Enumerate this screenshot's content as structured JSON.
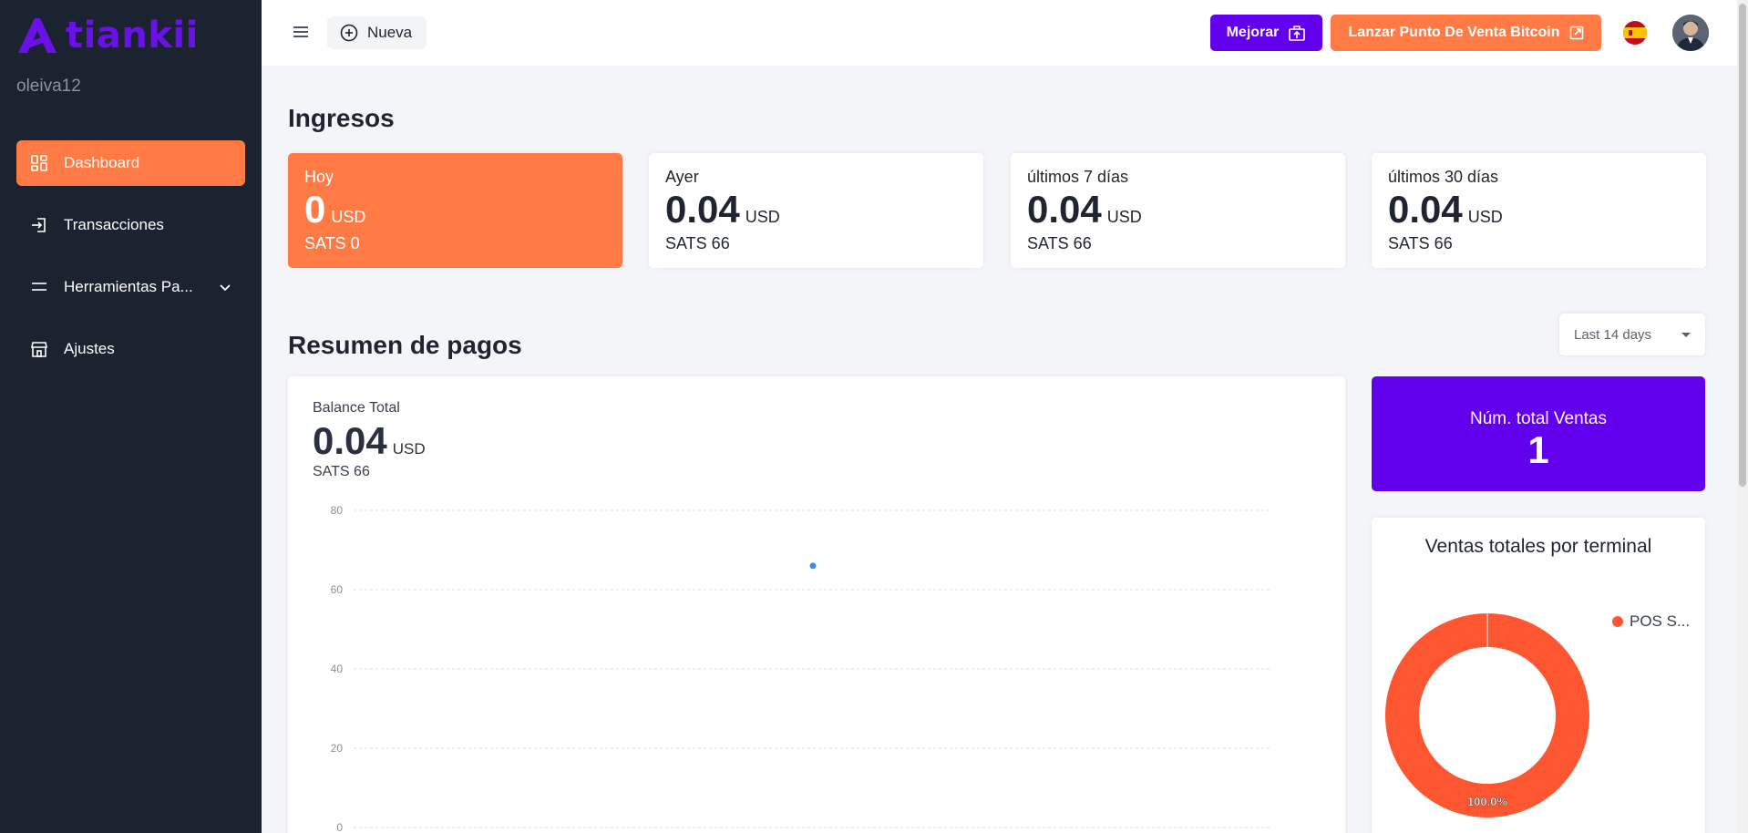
{
  "brand": {
    "name": "tiankii",
    "color": "#6a11e8"
  },
  "user": {
    "username": "oleiva12"
  },
  "sidebar": {
    "items": [
      {
        "label": "Dashboard",
        "icon": "dashboard-grid-icon",
        "active": true
      },
      {
        "label": "Transacciones",
        "icon": "transactions-icon"
      },
      {
        "label": "Herramientas Pa...",
        "icon": "tools-menu-icon",
        "expandable": true
      },
      {
        "label": "Ajustes",
        "icon": "store-icon"
      }
    ]
  },
  "header": {
    "nueva_label": "Nueva",
    "mejorar_label": "Mejorar",
    "lanzar_label": "Lanzar Punto De Venta Bitcoin",
    "language_flag": "spain-flag-icon"
  },
  "ingresos": {
    "title": "Ingresos",
    "cards": [
      {
        "label": "Hoy",
        "value": "0",
        "unit": "USD",
        "sats": "SATS 0"
      },
      {
        "label": "Ayer",
        "value": "0.04",
        "unit": "USD",
        "sats": "SATS 66"
      },
      {
        "label": "últimos 7 días",
        "value": "0.04",
        "unit": "USD",
        "sats": "SATS 66"
      },
      {
        "label": "últimos 30 días",
        "value": "0.04",
        "unit": "USD",
        "sats": "SATS 66"
      }
    ]
  },
  "resumen": {
    "title": "Resumen de pagos",
    "range_selected": "Last 14 days",
    "balance_label": "Balance Total",
    "balance_value": "0.04",
    "balance_unit": "USD",
    "balance_sats": "SATS 66"
  },
  "chart_data": {
    "type": "scatter",
    "title": "",
    "xlabel": "",
    "ylabel": "",
    "ylim": [
      0,
      80
    ],
    "yticks": [
      "80",
      "60",
      "40",
      "20",
      "0"
    ],
    "grid": true,
    "points": [
      {
        "x": 0.5,
        "y": 66
      }
    ],
    "point_color": "#3b8ee6"
  },
  "ventas": {
    "label": "Núm. total Ventas",
    "value": "1"
  },
  "terminal": {
    "title": "Ventas totales por terminal",
    "legend": "POS S...",
    "slices": [
      {
        "name": "POS S...",
        "value": 100,
        "label": "100.0%",
        "color": "#fd5631"
      }
    ]
  },
  "colors": {
    "accent": "#ff7a45",
    "primary": "#6200ee",
    "sidebar": "#1b2330"
  }
}
